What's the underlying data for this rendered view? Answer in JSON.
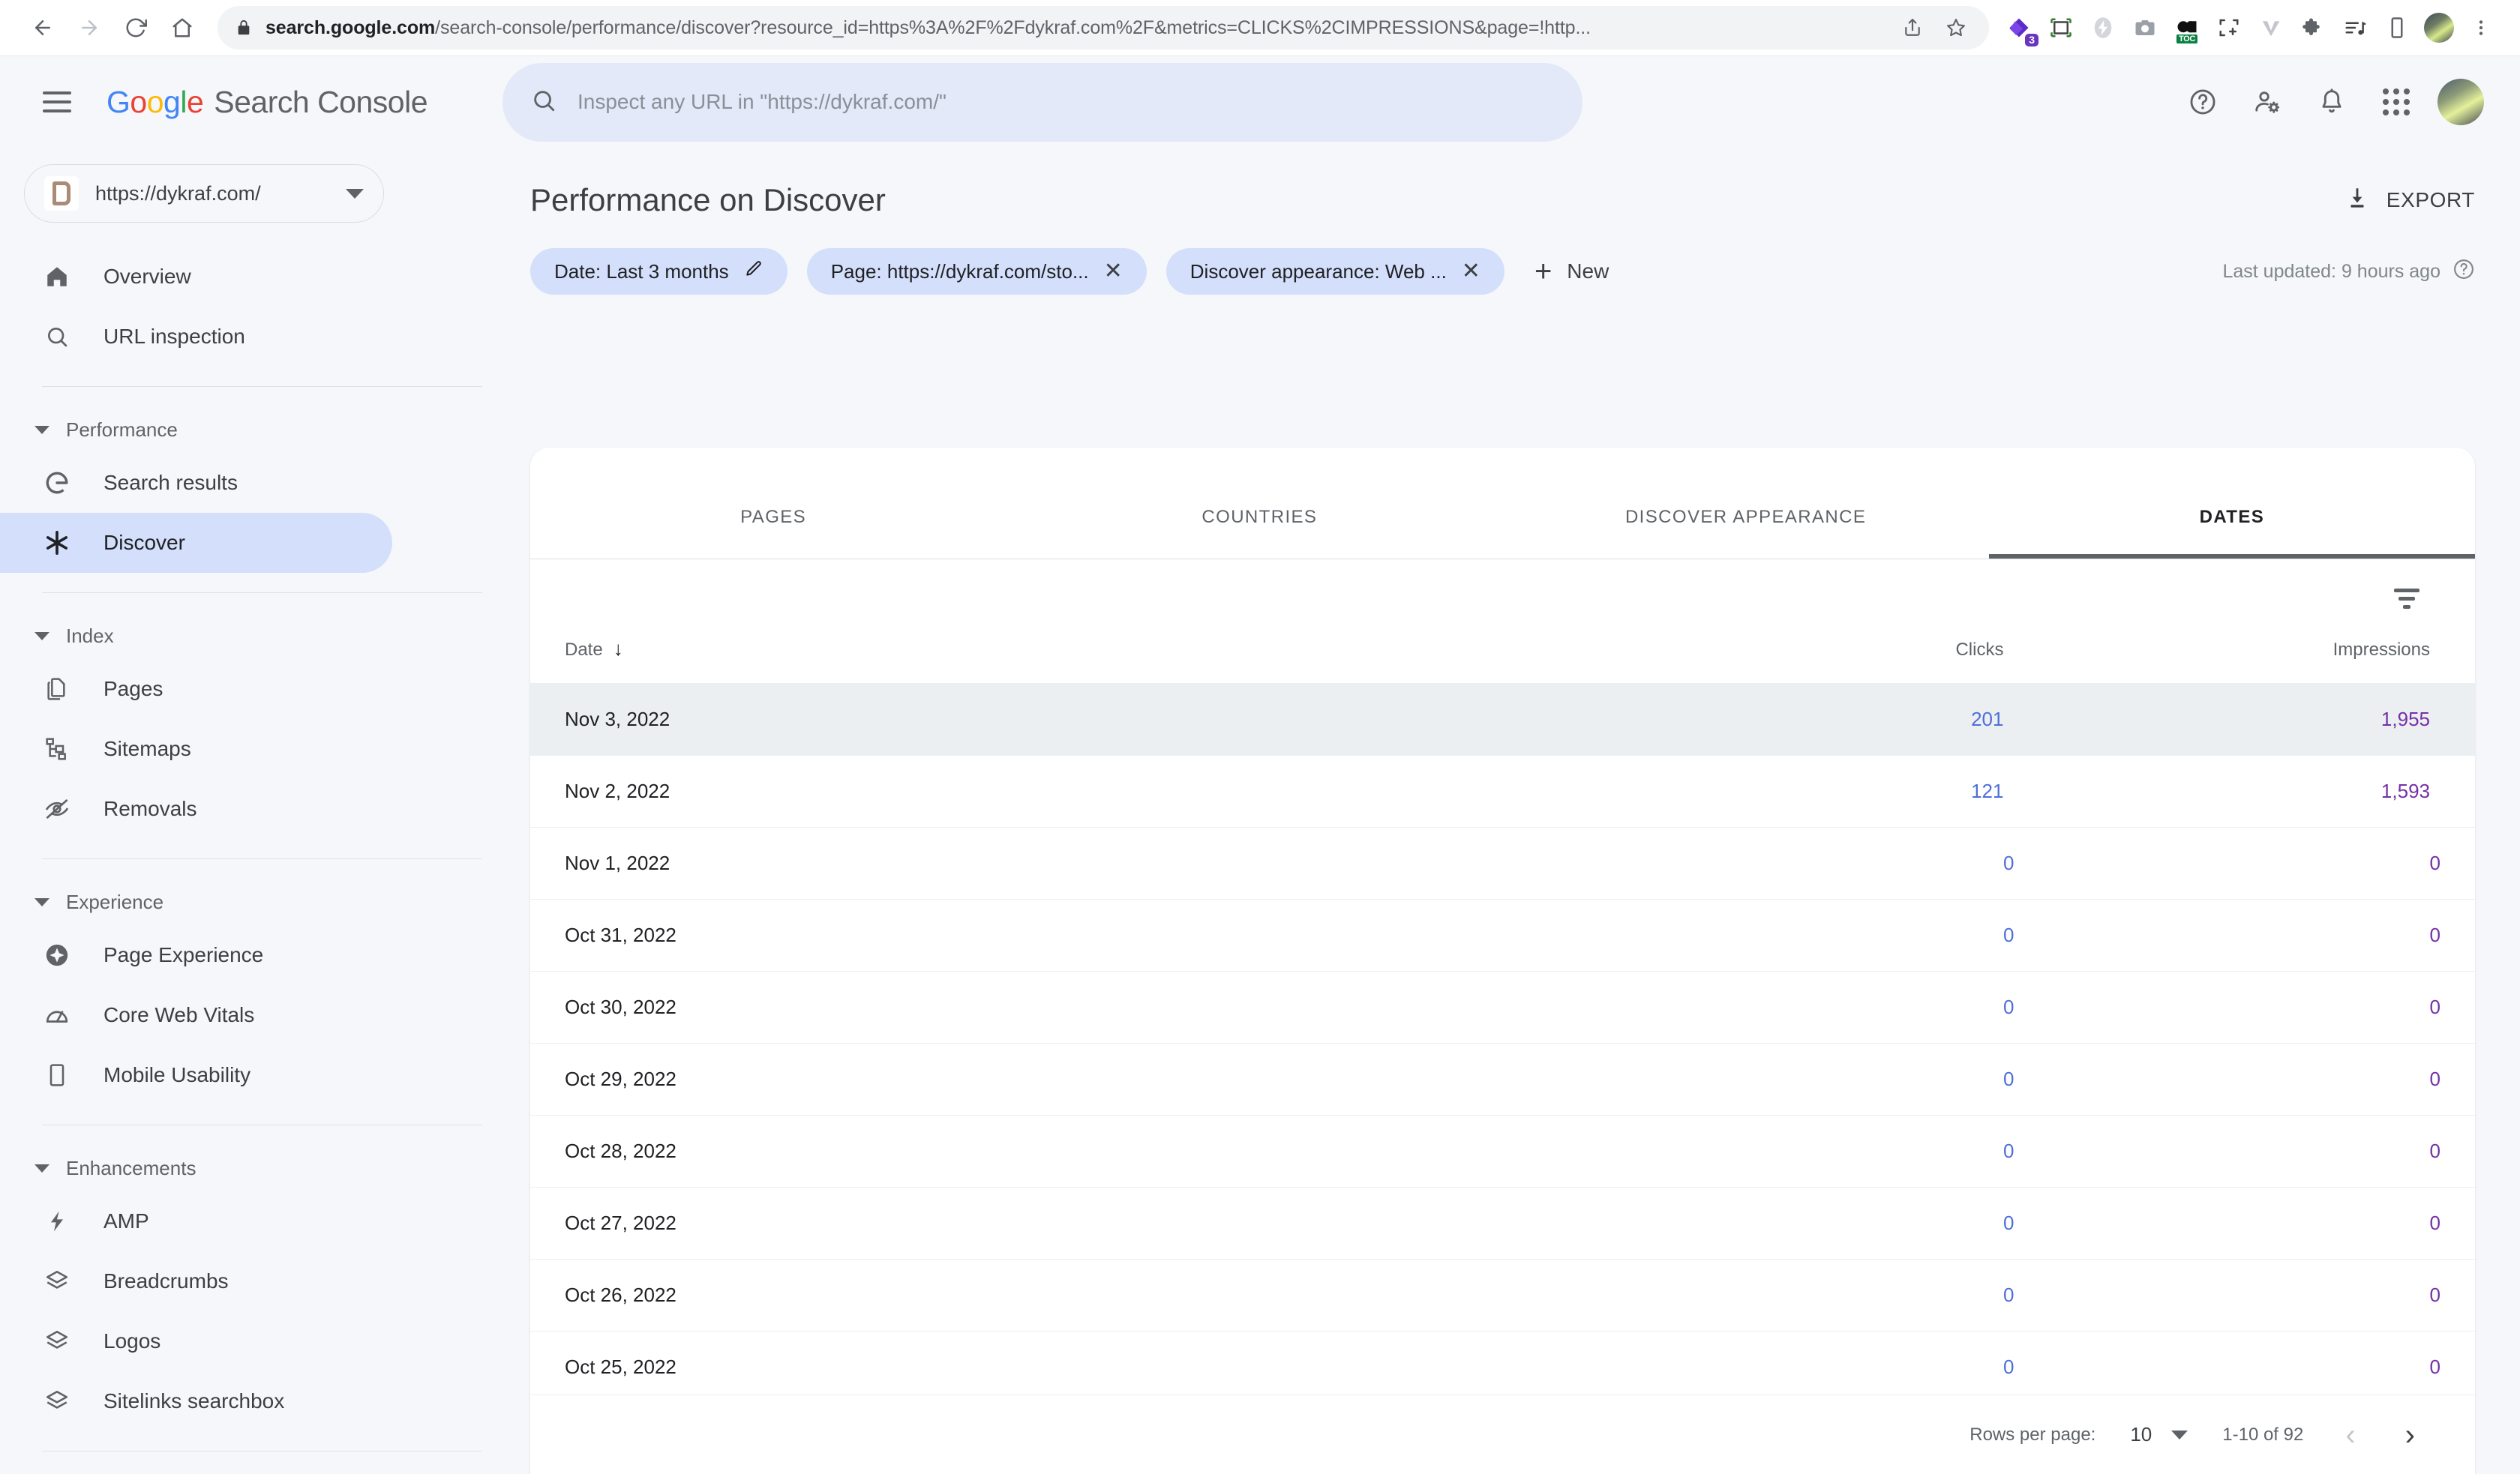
{
  "browser": {
    "back_icon": "back-arrow-icon",
    "forward_icon": "forward-arrow-icon",
    "reload_icon": "reload-icon",
    "home_icon": "home-icon",
    "lock_icon": "lock-icon",
    "url_bold": "search.google.com",
    "url_rest": "/search-console/performance/discover?resource_id=https%3A%2F%2Fdykraf.com%2F&metrics=CLICKS%2CIMPRESSIONS&page=!http...",
    "share_icon": "share-icon",
    "bookmark_icon": "bookmark-star-icon",
    "extensions": [
      {
        "name": "diamond-extension-icon",
        "badge": "3"
      },
      {
        "name": "screenshot-frame-icon",
        "badge": ""
      },
      {
        "name": "lightning-extension-icon",
        "badge": ""
      },
      {
        "name": "camera-extension-icon",
        "badge": ""
      },
      {
        "name": "toc-extension-icon",
        "badge": "TOC"
      },
      {
        "name": "capture-region-icon",
        "badge": ""
      },
      {
        "name": "v-extension-icon",
        "badge": ""
      },
      {
        "name": "puzzle-extensions-icon",
        "badge": ""
      },
      {
        "name": "playlist-music-icon",
        "badge": ""
      },
      {
        "name": "mobile-device-icon",
        "badge": ""
      }
    ],
    "profile_icon": "browser-profile-avatar",
    "menu_icon": "three-dot-menu-icon"
  },
  "app_header": {
    "menu_icon": "hamburger-menu-icon",
    "logo_letters": [
      "G",
      "o",
      "o",
      "g",
      "l",
      "e"
    ],
    "product_name": "Search Console",
    "search_placeholder": "Inspect any URL in \"https://dykraf.com/\"",
    "search_icon": "search-icon",
    "help_icon": "help-circle-icon",
    "account_settings_icon": "user-settings-icon",
    "notifications_icon": "bell-icon",
    "apps_icon": "apps-grid-icon",
    "avatar": "user-avatar"
  },
  "sidebar": {
    "property": {
      "icon": "site-favicon",
      "url": "https://dykraf.com/",
      "caret": "chevron-down-icon"
    },
    "top_items": [
      {
        "label": "Overview",
        "icon": "home-icon",
        "active": false
      },
      {
        "label": "URL inspection",
        "icon": "search-icon",
        "active": false
      }
    ],
    "groups": [
      {
        "label": "Performance",
        "items": [
          {
            "label": "Search results",
            "icon": "google-g-icon",
            "active": false
          },
          {
            "label": "Discover",
            "icon": "discover-asterisk-icon",
            "active": true
          }
        ]
      },
      {
        "label": "Index",
        "items": [
          {
            "label": "Pages",
            "icon": "pages-copy-icon",
            "active": false
          },
          {
            "label": "Sitemaps",
            "icon": "sitemap-tree-icon",
            "active": false
          },
          {
            "label": "Removals",
            "icon": "eye-off-icon",
            "active": false
          }
        ]
      },
      {
        "label": "Experience",
        "items": [
          {
            "label": "Page Experience",
            "icon": "page-experience-icon",
            "active": false
          },
          {
            "label": "Core Web Vitals",
            "icon": "speedometer-icon",
            "active": false
          },
          {
            "label": "Mobile Usability",
            "icon": "mobile-phone-icon",
            "active": false
          }
        ]
      },
      {
        "label": "Enhancements",
        "items": [
          {
            "label": "AMP",
            "icon": "lightning-bolt-icon",
            "active": false
          },
          {
            "label": "Breadcrumbs",
            "icon": "layers-icon",
            "active": false
          },
          {
            "label": "Logos",
            "icon": "layers-icon",
            "active": false
          },
          {
            "label": "Sitelinks searchbox",
            "icon": "layers-icon",
            "active": false
          }
        ]
      }
    ]
  },
  "main": {
    "page_title": "Performance on Discover",
    "export": {
      "label": "EXPORT",
      "icon": "download-icon"
    },
    "chips": [
      {
        "label": "Date: Last 3 months",
        "action_icon": "edit-pencil-icon"
      },
      {
        "label": "Page: https://dykraf.com/sto...",
        "action_icon": "close-x-icon"
      },
      {
        "label": "Discover appearance: Web ...",
        "action_icon": "close-x-icon"
      }
    ],
    "new_filter": {
      "label": "New",
      "icon": "plus-icon"
    },
    "last_updated": {
      "text": "Last updated: 9 hours ago",
      "icon": "help-circle-icon"
    },
    "tabs": [
      {
        "label": "PAGES",
        "active": false
      },
      {
        "label": "COUNTRIES",
        "active": false
      },
      {
        "label": "DISCOVER APPEARANCE",
        "active": false
      },
      {
        "label": "DATES",
        "active": true
      }
    ],
    "filter_icon": "filter-funnel-icon",
    "table": {
      "columns": [
        "Date",
        "Clicks",
        "Impressions"
      ],
      "sort_icon": "sort-descending-arrow",
      "rows": [
        {
          "date": "Nov 3, 2022",
          "clicks": "201",
          "impressions": "1,955",
          "highlighted": true
        },
        {
          "date": "Nov 2, 2022",
          "clicks": "121",
          "impressions": "1,593",
          "highlighted": false
        },
        {
          "date": "Nov 1, 2022",
          "clicks": "0",
          "impressions": "0",
          "highlighted": false
        },
        {
          "date": "Oct 31, 2022",
          "clicks": "0",
          "impressions": "0",
          "highlighted": false
        },
        {
          "date": "Oct 30, 2022",
          "clicks": "0",
          "impressions": "0",
          "highlighted": false
        },
        {
          "date": "Oct 29, 2022",
          "clicks": "0",
          "impressions": "0",
          "highlighted": false
        },
        {
          "date": "Oct 28, 2022",
          "clicks": "0",
          "impressions": "0",
          "highlighted": false
        },
        {
          "date": "Oct 27, 2022",
          "clicks": "0",
          "impressions": "0",
          "highlighted": false
        },
        {
          "date": "Oct 26, 2022",
          "clicks": "0",
          "impressions": "0",
          "highlighted": false
        },
        {
          "date": "Oct 25, 2022",
          "clicks": "0",
          "impressions": "0",
          "highlighted": false
        }
      ]
    },
    "pagination": {
      "rows_label": "Rows per page:",
      "rows_value": "10",
      "range": "1-10 of 92",
      "prev_icon": "chevron-left-icon",
      "next_icon": "chevron-right-icon"
    }
  },
  "colors": {
    "clicks": "#4e6edb",
    "impressions": "#7530a8",
    "active_nav": "#d3dffb",
    "chip_bg": "#d3dffb",
    "app_bg": "#f5f7fa"
  }
}
